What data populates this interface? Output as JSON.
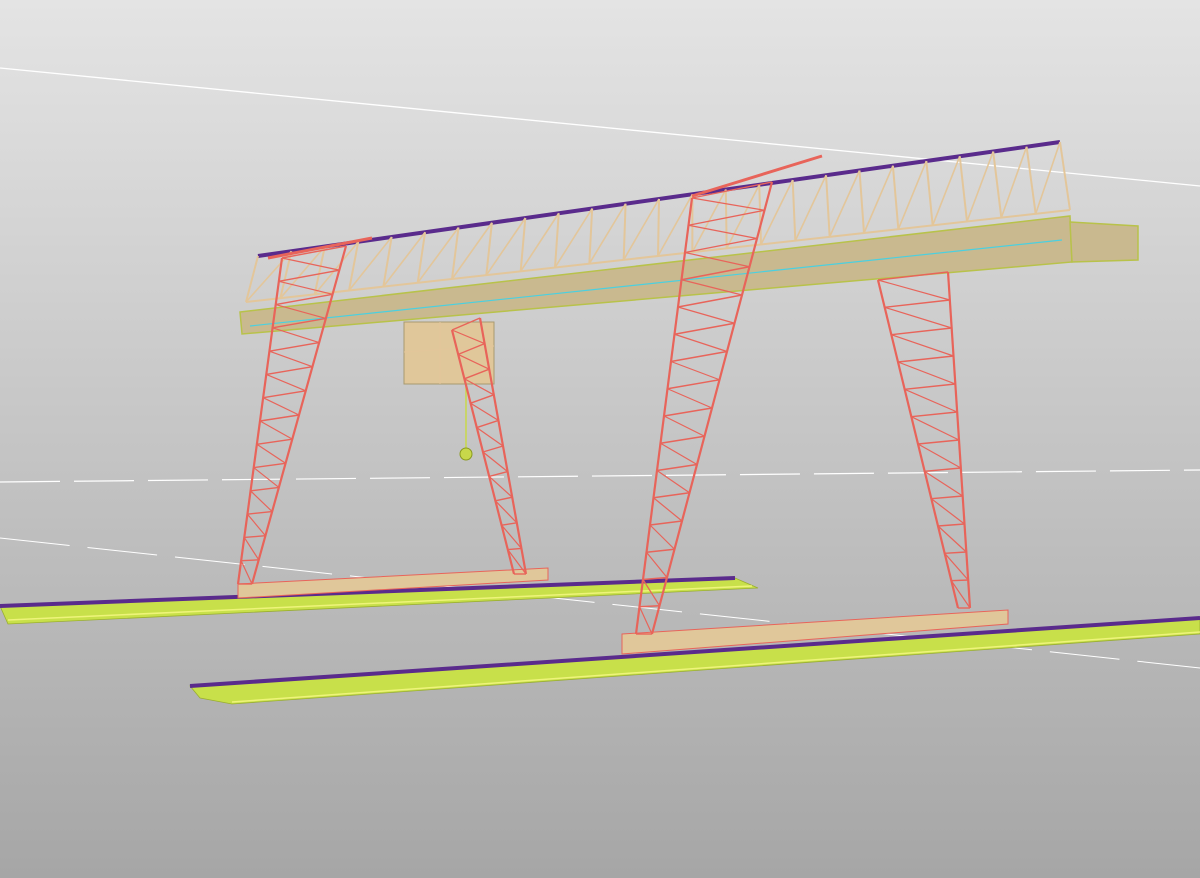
{
  "scene": {
    "subject": "gantry-crane-wireframe",
    "colors": {
      "background_top": "#e4e4e4",
      "background_bottom": "#a6a6a6",
      "leg_truss": "#e8645a",
      "girder_truss": "#e3c69a",
      "girder_outline": "#b8c24a",
      "rail_top": "#5a2b8c",
      "rail_side": "#c8e04a",
      "horizon_line": "#ffffff",
      "trolley": "#e0c79a",
      "hook": "#c8d84a"
    }
  }
}
